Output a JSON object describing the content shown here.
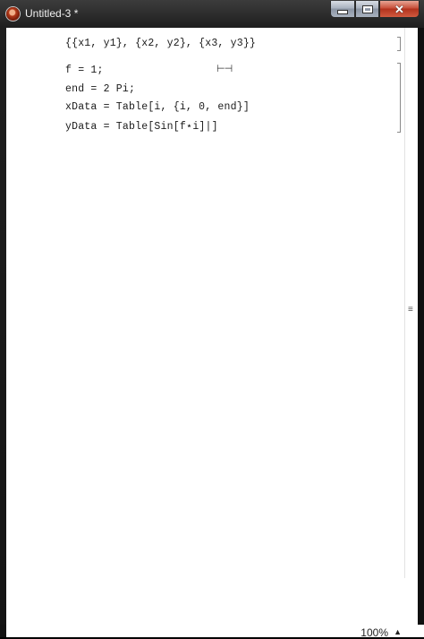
{
  "window": {
    "title": "Untitled-3 *"
  },
  "cells": {
    "cell1": {
      "line1": "{{x1, y1}, {x2, y2}, {x3, y3}}"
    },
    "cell2": {
      "lines": [
        "f = 1;",
        "end = 2 Pi;",
        "xData = Table[i, {i, 0, end}]",
        "yData = Table[Sin[f⋆i]|]"
      ]
    }
  },
  "status": {
    "zoom": "100%"
  },
  "icons": {
    "app": "mathematica-icon",
    "cursor": "insertion-cursor-icon",
    "minimize": "minimize-icon",
    "maximize": "maximize-icon",
    "close": "close-icon",
    "scroll_grip": "scroll-grip-icon",
    "zoom_menu": "chevron-up-icon"
  }
}
